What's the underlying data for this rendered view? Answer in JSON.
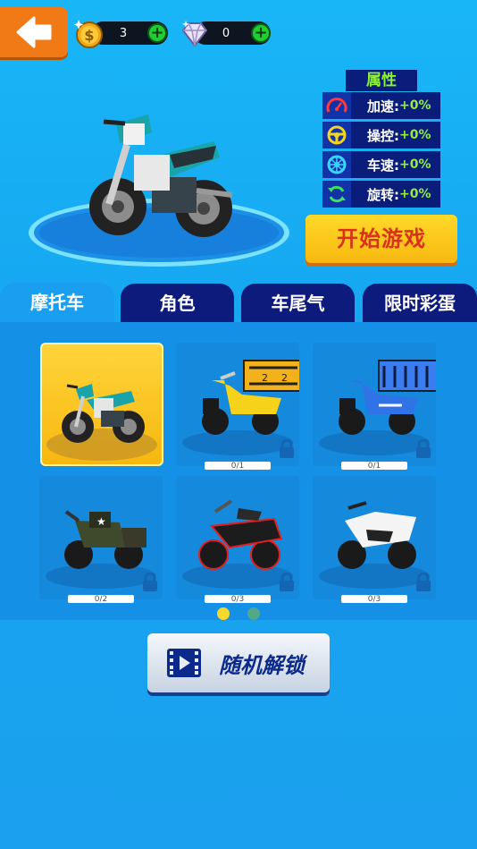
{
  "topbar": {
    "coins": "3",
    "gems": "0"
  },
  "attributes": {
    "title": "属性",
    "rows": [
      {
        "label": "加速:",
        "value": "+0%",
        "icon": "speedometer-icon"
      },
      {
        "label": "操控:",
        "value": "+0%",
        "icon": "steering-wheel-icon"
      },
      {
        "label": "车速:",
        "value": "+0%",
        "icon": "wheel-icon"
      },
      {
        "label": "旋转:",
        "value": "+0%",
        "icon": "rotate-icon"
      }
    ]
  },
  "start_button": "开始游戏",
  "tabs": [
    "摩托车",
    "角色",
    "车尾气",
    "限时彩蛋"
  ],
  "active_tab": 0,
  "items": [
    {
      "name": "dirt-bike",
      "selected": true,
      "locked": false,
      "progress": ""
    },
    {
      "name": "yellow-delivery-scooter",
      "selected": false,
      "locked": true,
      "progress": "0/1"
    },
    {
      "name": "blue-delivery-scooter",
      "selected": false,
      "locked": true,
      "progress": "0/1"
    },
    {
      "name": "military-sidecar-bike",
      "selected": false,
      "locked": true,
      "progress": "0/2"
    },
    {
      "name": "red-neon-cruiser",
      "selected": false,
      "locked": true,
      "progress": "0/3"
    },
    {
      "name": "white-sport-bike",
      "selected": false,
      "locked": true,
      "progress": "0/3"
    }
  ],
  "pagination": {
    "current": 1,
    "total": 2,
    "active_color": "#f6d82a",
    "inactive_color": "#4fa98a"
  },
  "random_unlock": "随机解锁",
  "colors": {
    "background": "#19b6f7",
    "tab_dark": "#0d1b7c",
    "accent_green": "#8ef23a",
    "start_yellow": "#ffd92a"
  }
}
